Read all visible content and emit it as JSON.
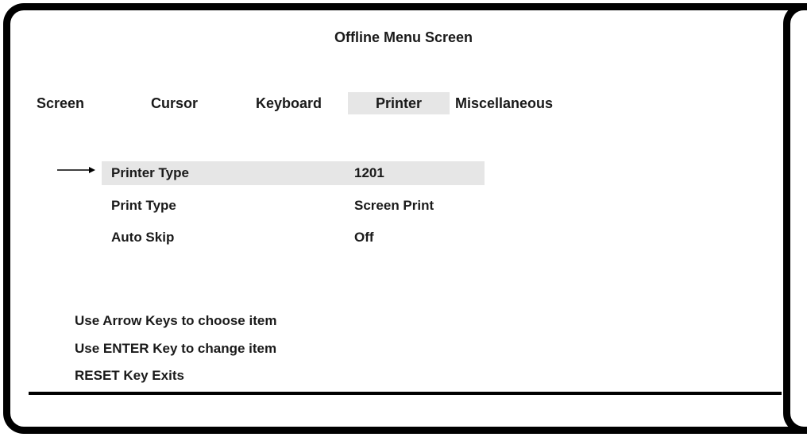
{
  "title": "Offline Menu Screen",
  "tabs": [
    {
      "label": "Screen",
      "active": false
    },
    {
      "label": "Cursor",
      "active": false
    },
    {
      "label": "Keyboard",
      "active": false
    },
    {
      "label": "Printer",
      "active": true
    },
    {
      "label": "Miscellaneous",
      "active": false
    }
  ],
  "items": [
    {
      "label": "Printer Type",
      "value": "1201",
      "selected": true
    },
    {
      "label": "Print Type",
      "value": "Screen Print",
      "selected": false
    },
    {
      "label": "Auto Skip",
      "value": "Off",
      "selected": false
    }
  ],
  "help": [
    "Use Arrow Keys to choose item",
    "Use ENTER Key to change item",
    "RESET Key Exits"
  ],
  "icons": {
    "selection_pointer": "right-arrow-icon"
  },
  "colors": {
    "frame": "#000000",
    "highlight": "#e6e6e6",
    "text": "#1a1a1a"
  }
}
